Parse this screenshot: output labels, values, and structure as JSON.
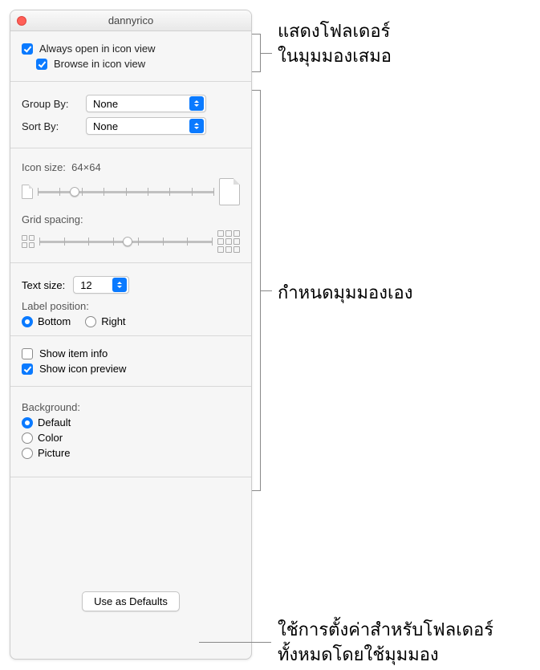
{
  "window": {
    "title": "dannyrico"
  },
  "top": {
    "always_open": "Always open in icon view",
    "browse": "Browse in icon view"
  },
  "group_sort": {
    "group_by_label": "Group By:",
    "group_by_value": "None",
    "sort_by_label": "Sort By:",
    "sort_by_value": "None"
  },
  "icon": {
    "size_label": "Icon size:",
    "size_value": "64×64",
    "grid_label": "Grid spacing:"
  },
  "text": {
    "size_label": "Text size:",
    "size_value": "12",
    "label_pos": "Label position:",
    "bottom": "Bottom",
    "right": "Right"
  },
  "show": {
    "item_info": "Show item info",
    "icon_preview": "Show icon preview"
  },
  "background": {
    "header": "Background:",
    "default": "Default",
    "color": "Color",
    "picture": "Picture"
  },
  "defaults_btn": "Use as Defaults",
  "annotations": {
    "a1_l1": "แสดงโฟลเดอร์",
    "a1_l2": "ในมุมมองเสมอ",
    "a2": "กำหนดมุมมองเอง",
    "a3_l1": "ใช้การตั้งค่าสำหรับโฟลเดอร์",
    "a3_l2": "ทั้งหมดโดยใช้มุมมอง"
  }
}
